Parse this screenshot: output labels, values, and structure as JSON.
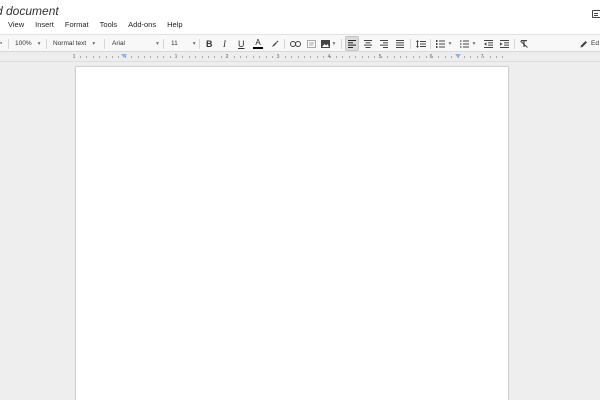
{
  "document": {
    "title": "d document"
  },
  "menu": {
    "items": [
      "View",
      "Insert",
      "Format",
      "Tools",
      "Add-ons",
      "Help"
    ]
  },
  "toolbar": {
    "zoom": "100%",
    "style": "Normal text",
    "font": "Arial",
    "font_size": "11",
    "bold_label": "B",
    "italic_label": "I",
    "underline_label": "U",
    "text_color_label": "A",
    "text_color": "#000000",
    "editing_label": "Ed"
  },
  "ruler": {
    "numbers": [
      "1",
      "1",
      "2",
      "3",
      "4",
      "5",
      "6",
      "7"
    ]
  },
  "icons": [
    "comments-icon",
    "link-icon",
    "comment-icon",
    "image-icon",
    "align-left-icon",
    "align-center-icon",
    "align-right-icon",
    "justify-icon",
    "line-spacing-icon",
    "numbered-list-icon",
    "bulleted-list-icon",
    "decrease-indent-icon",
    "increase-indent-icon",
    "clear-formatting-icon",
    "pencil-icon",
    "highlighter-icon"
  ]
}
